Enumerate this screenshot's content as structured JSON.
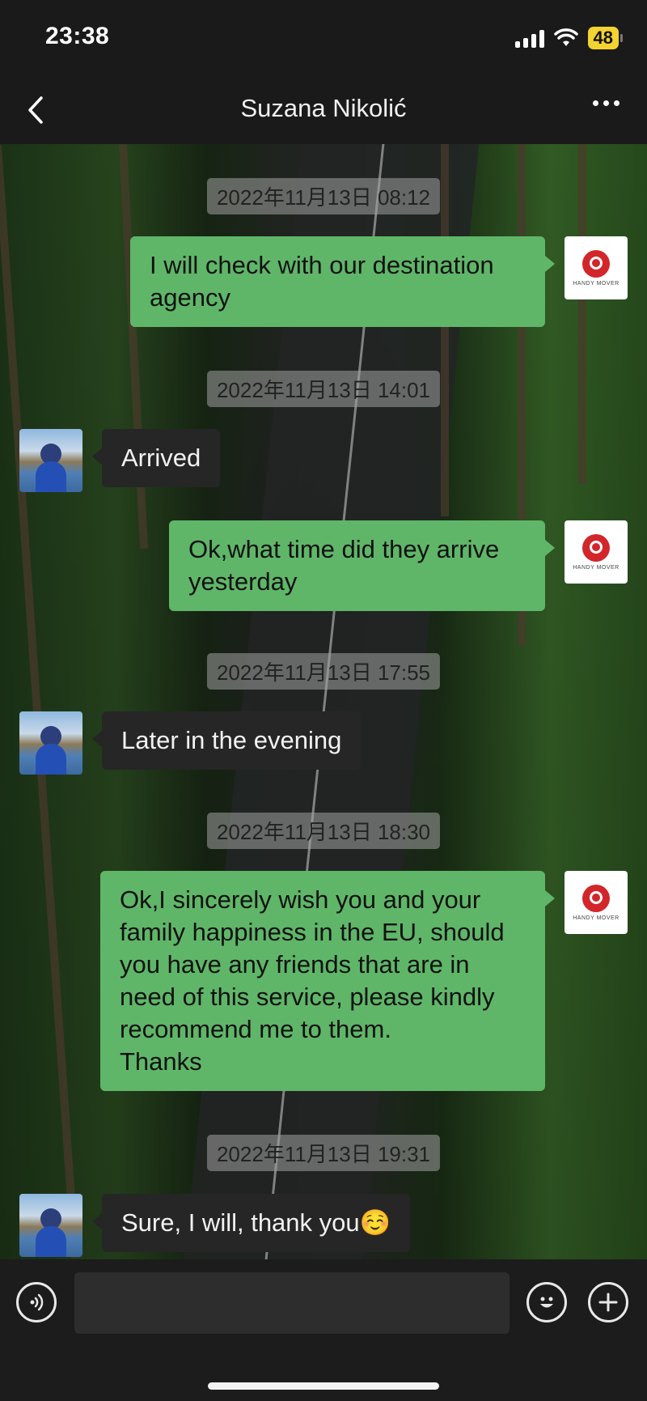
{
  "status_bar": {
    "time": "23:38",
    "battery": "48"
  },
  "header": {
    "title": "Suzana Nikolić"
  },
  "messages": [
    {
      "timestamp": "2022年11月13日 08:12",
      "sender": "me",
      "text": "I will check with our destination agency"
    },
    {
      "timestamp": "2022年11月13日 14:01",
      "sender": "contact",
      "text": "Arrived"
    },
    {
      "sender": "me",
      "text": "Ok,what time did they arrive yesterday"
    },
    {
      "timestamp": "2022年11月13日 17:55",
      "sender": "contact",
      "text": "Later in the evening"
    },
    {
      "timestamp": "2022年11月13日 18:30",
      "sender": "me",
      "text": "Ok,I sincerely wish you and your family happiness in the EU, should\n you have any friends that are in need of this service, please kindly recommend me to them.\nThanks"
    },
    {
      "timestamp": "2022年11月13日 19:31",
      "sender": "contact",
      "text": "Sure, I will, thank you☺️"
    }
  ],
  "avatars": {
    "me_brand": "HANDY MOVER"
  },
  "input": {
    "value": ""
  },
  "icons": {
    "back": "chevron-left-icon",
    "more": "more-icon",
    "voice": "voice-icon",
    "emoji": "emoji-icon",
    "add": "plus-icon"
  },
  "colors": {
    "bubble_me": "#5fb668",
    "bubble_contact": "#262626",
    "battery": "#f3d330"
  }
}
